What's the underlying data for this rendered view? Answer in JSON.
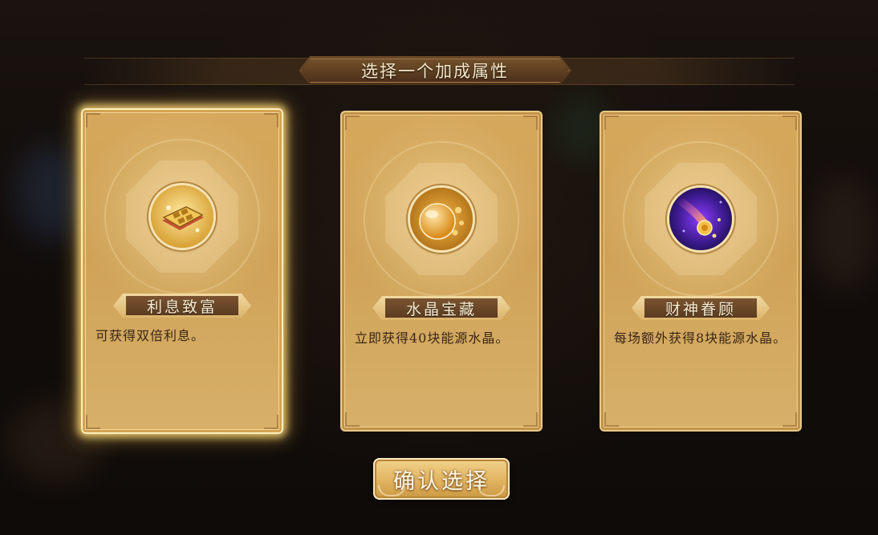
{
  "header": {
    "title": "选择一个加成属性"
  },
  "cards": [
    {
      "name": "利息致富",
      "desc": "可获得双倍利息。",
      "icon": "gold-ledger-icon",
      "selected": true
    },
    {
      "name": "水晶宝藏",
      "desc": "立即获得40块能源水晶。",
      "icon": "amber-crystal-orb-icon",
      "selected": false
    },
    {
      "name": "财神眷顾",
      "desc": "每场额外获得8块能源水晶。",
      "icon": "cosmic-comet-coin-icon",
      "selected": false
    }
  ],
  "footer": {
    "confirm_label": "确认选择"
  },
  "colors": {
    "card_gold": "#d5a85c",
    "selected_glow": "#ffdc78",
    "plate_brown": "#6b4525",
    "text_dark": "#3a2614"
  }
}
